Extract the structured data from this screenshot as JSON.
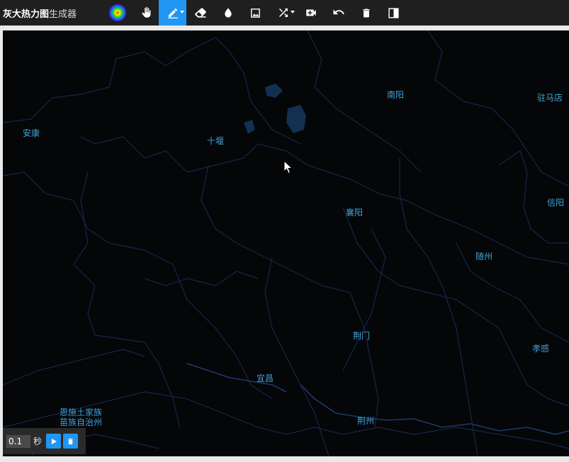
{
  "app": {
    "title_bold": "灰大热力图",
    "title_rest": " 生成器"
  },
  "toolbar": {
    "tools": [
      {
        "name": "gradient-tool",
        "icon": "heat-gradient-icon",
        "active": false
      },
      {
        "name": "pan-tool",
        "icon": "hand-icon",
        "active": false
      },
      {
        "name": "pencil-tool",
        "icon": "pencil-icon",
        "active": true,
        "has_dropdown": true
      },
      {
        "name": "eraser-tool",
        "icon": "eraser-icon",
        "active": false
      },
      {
        "name": "drop-tool",
        "icon": "drop-icon",
        "active": false
      },
      {
        "name": "image-tool",
        "icon": "image-icon",
        "active": false
      },
      {
        "name": "shuffle-tool",
        "icon": "shuffle-icon",
        "active": false,
        "has_dropdown": true
      },
      {
        "name": "record-tool",
        "icon": "video-add-icon",
        "active": false
      },
      {
        "name": "undo-tool",
        "icon": "undo-icon",
        "active": false
      },
      {
        "name": "delete-tool",
        "icon": "trash-icon",
        "active": false
      },
      {
        "name": "split-tool",
        "icon": "split-view-icon",
        "active": false
      }
    ],
    "active_color": "#2196f3"
  },
  "map": {
    "background": "#050608",
    "label_color": "#3fa3d9",
    "cities": [
      {
        "name": "南阳"
      },
      {
        "name": "驻马店"
      },
      {
        "name": "安康"
      },
      {
        "name": "十堰"
      },
      {
        "name": "信阳"
      },
      {
        "name": "襄阳"
      },
      {
        "name": "随州"
      },
      {
        "name": "荆门"
      },
      {
        "name": "孝感"
      },
      {
        "name": "宜昌"
      },
      {
        "name": "恩施土家族"
      },
      {
        "name": "苗族自治州"
      },
      {
        "name": "荆州"
      }
    ]
  },
  "controls": {
    "interval_value": "0.1",
    "unit_label": "秒",
    "play_icon": "play-icon",
    "clear_icon": "trash-icon"
  }
}
